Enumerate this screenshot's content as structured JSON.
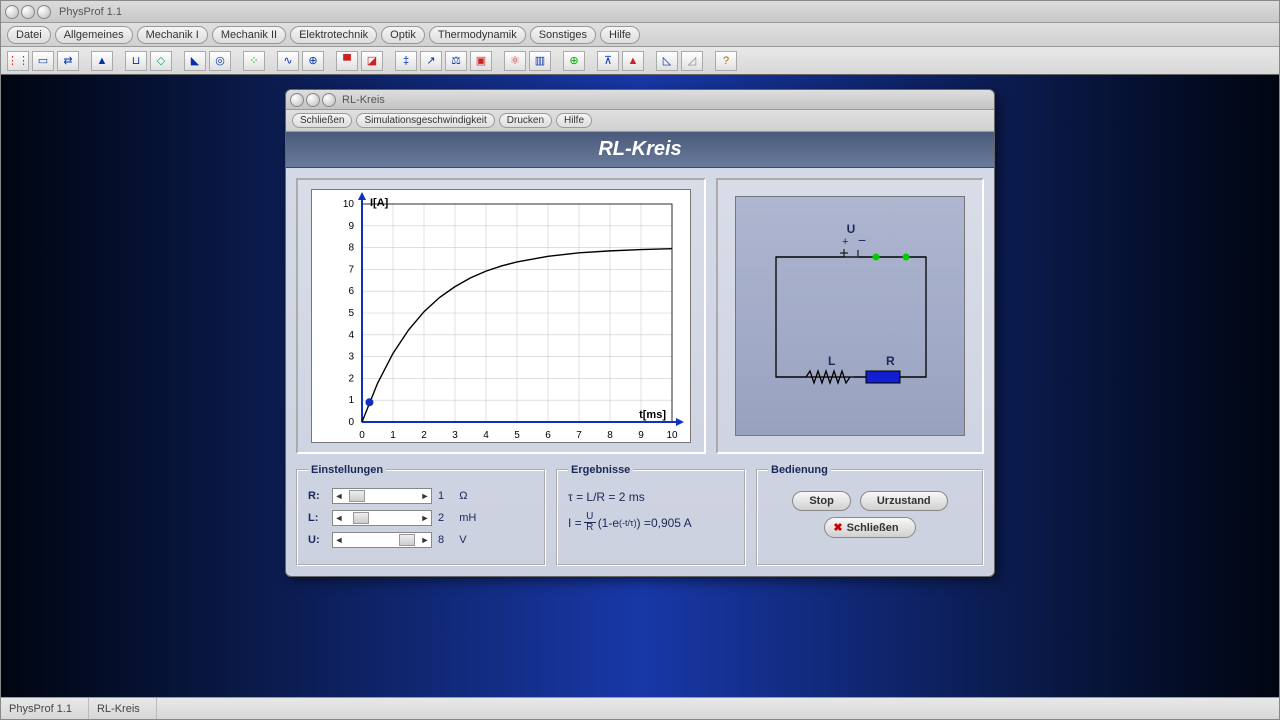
{
  "app": {
    "title": "PhysProf 1.1"
  },
  "menu": [
    "Datei",
    "Allgemeines",
    "Mechanik I",
    "Mechanik II",
    "Elektrotechnik",
    "Optik",
    "Thermodynamik",
    "Sonstiges",
    "Hilfe"
  ],
  "status": {
    "app": "PhysProf 1.1",
    "doc": "RL-Kreis"
  },
  "child": {
    "title": "RL-Kreis",
    "menu": [
      "Schließen",
      "Simulationsgeschwindigkeit",
      "Drucken",
      "Hilfe"
    ],
    "heading": "RL-Kreis"
  },
  "graph": {
    "ylabel": "I[A]",
    "xlabel": "t[ms]",
    "yticks": [
      0,
      1,
      2,
      3,
      4,
      5,
      6,
      7,
      8,
      9,
      10
    ],
    "xticks": [
      0,
      1,
      2,
      3,
      4,
      5,
      6,
      7,
      8,
      9,
      10
    ],
    "marker_t": 0.24
  },
  "chart_data": {
    "type": "line",
    "title": "RL-Kreis",
    "xlabel": "t[ms]",
    "ylabel": "I[A]",
    "xlim": [
      0,
      10
    ],
    "ylim": [
      0,
      10
    ],
    "description": "I(t) = (U/R)(1 - e^{-t/τ}) with U=8 V, R=1 Ω, τ=2 ms; asymptote at I=8 A",
    "x": [
      0,
      0.5,
      1,
      1.5,
      2,
      2.5,
      3,
      3.5,
      4,
      4.5,
      5,
      6,
      7,
      8,
      9,
      10
    ],
    "y": [
      0,
      1.77,
      3.15,
      4.22,
      5.06,
      5.71,
      6.21,
      6.61,
      6.92,
      7.16,
      7.34,
      7.6,
      7.76,
      7.85,
      7.91,
      7.95
    ],
    "marker": {
      "t": 0.24,
      "I": 0.905
    }
  },
  "circuit": {
    "U": "U",
    "L": "L",
    "R": "R"
  },
  "settings": {
    "legend": "Einstellungen",
    "R": {
      "label": "R:",
      "value": "1",
      "unit": "Ω",
      "pos": 4
    },
    "L": {
      "label": "L:",
      "value": "2",
      "unit": "mH",
      "pos": 8
    },
    "U": {
      "label": "U:",
      "value": "8",
      "unit": "V",
      "pos": 54
    }
  },
  "results": {
    "legend": "Ergebnisse",
    "tau_label": "τ  = L/R  =  ",
    "tau_value": "2 ms",
    "I_prefix": "I  =  ",
    "I_eq1": "U",
    "I_eq2": "R",
    "I_eq3": "(1-e",
    "I_eq_exp": "(-t/τ)",
    "I_eq4": ")   =   ",
    "I_value": "0,905 A"
  },
  "controls": {
    "legend": "Bedienung",
    "stop": "Stop",
    "reset": "Urzustand",
    "close": "Schließen"
  }
}
